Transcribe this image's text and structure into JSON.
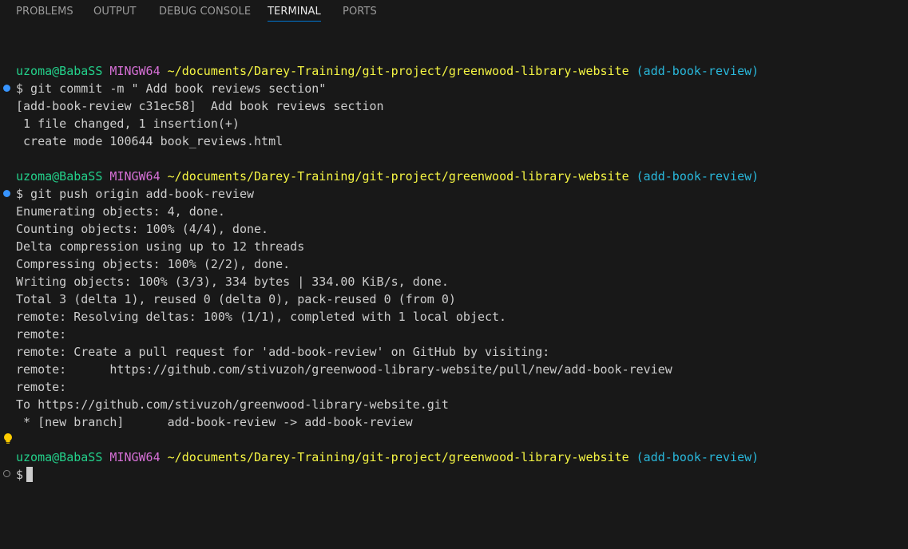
{
  "tabs": [
    {
      "label": "PROBLEMS"
    },
    {
      "label": "OUTPUT"
    },
    {
      "label": "DEBUG CONSOLE"
    },
    {
      "label": "TERMINAL",
      "active": true
    },
    {
      "label": "PORTS"
    }
  ],
  "prompt": {
    "user": "uzoma@BabaSS",
    "system": "MINGW64",
    "path": "~/documents/Darey-Training/git-project/greenwood-library-website",
    "branch": "(add-book-review)"
  },
  "commands": {
    "commit": "$ git commit -m \" Add book reviews section\"",
    "push": "$ git push origin add-book-review",
    "current": "$"
  },
  "output": {
    "commit": [
      "[add-book-review c31ec58]  Add book reviews section",
      " 1 file changed, 1 insertion(+)",
      " create mode 100644 book_reviews.html"
    ],
    "push": [
      "Enumerating objects: 4, done.",
      "Counting objects: 100% (4/4), done.",
      "Delta compression using up to 12 threads",
      "Compressing objects: 100% (2/2), done.",
      "Writing objects: 100% (3/3), 334 bytes | 334.00 KiB/s, done.",
      "Total 3 (delta 1), reused 0 (delta 0), pack-reused 0 (from 0)",
      "remote: Resolving deltas: 100% (1/1), completed with 1 local object.",
      "remote:",
      "remote: Create a pull request for 'add-book-review' on GitHub by visiting:",
      "remote:      https://github.com/stivuzoh/greenwood-library-website/pull/new/add-book-review",
      "remote:",
      "To https://github.com/stivuzoh/greenwood-library-website.git",
      " * [new branch]      add-book-review -> add-book-review"
    ]
  },
  "colors": {
    "background": "#181818",
    "user": "#23d18b",
    "system": "#d670d6",
    "path": "#f5f543",
    "branch": "#29b8db",
    "active_tab_underline": "#0078d4"
  },
  "icons": {
    "success_decoration": "circle-dot-icon",
    "default_decoration": "circle-outline-icon",
    "quick_fix": "lightbulb-icon"
  }
}
